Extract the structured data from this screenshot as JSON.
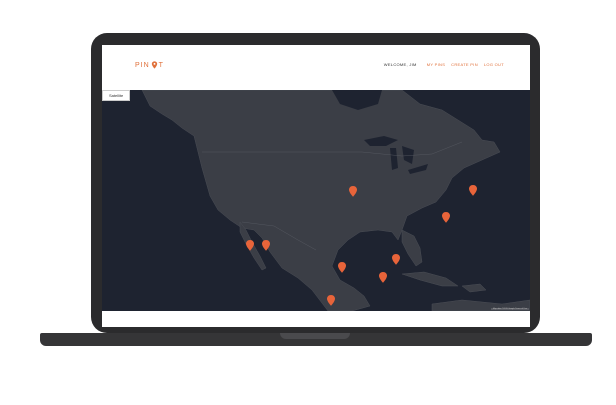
{
  "app": {
    "logo_text_left": "PIN",
    "logo_text_right": "T"
  },
  "nav": {
    "welcome": "WELCOME, JIM",
    "links": [
      "MY PINS",
      "CREATE PIN",
      "LOG OUT"
    ]
  },
  "map": {
    "type_button": "Satellite",
    "attribution": "Map data ©2019 Google  Terms of Use",
    "pin_color": "#e8643a",
    "pin_count": 10
  },
  "colors": {
    "accent": "#e0703a",
    "map_water": "#1e2330",
    "map_land": "#3a3d44"
  }
}
